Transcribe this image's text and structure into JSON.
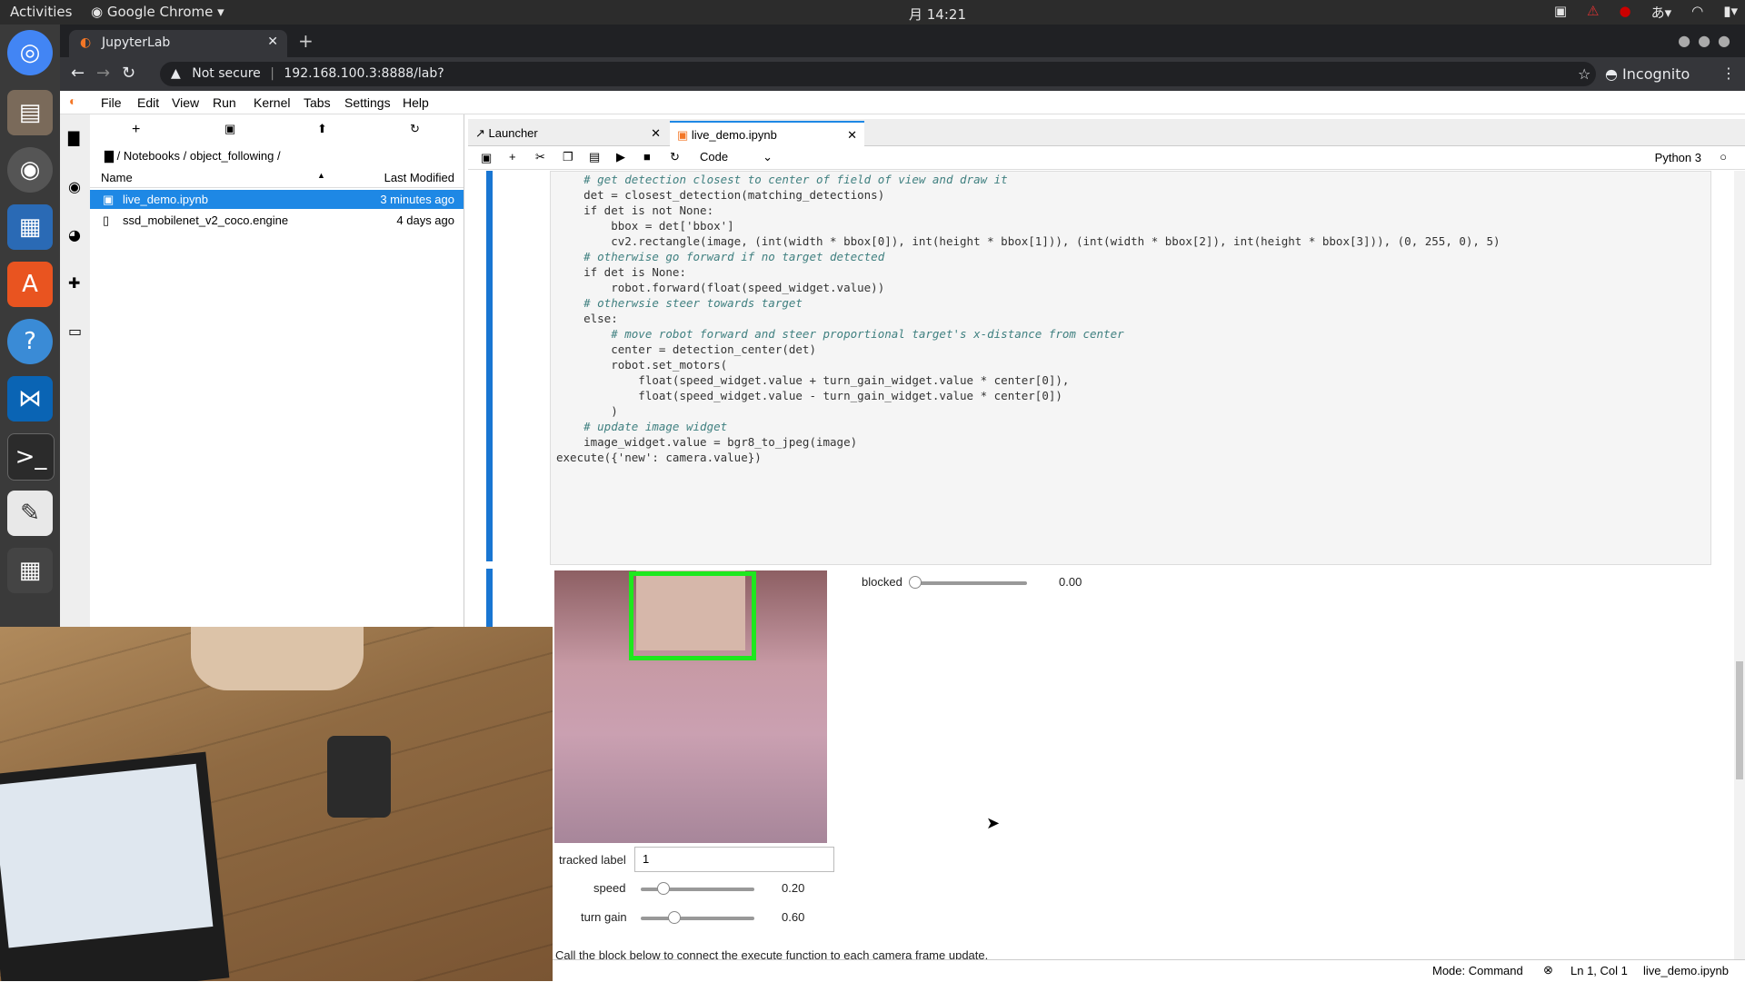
{
  "topbar": {
    "activities": "Activities",
    "app": "Google Chrome",
    "clock": "月 14:21"
  },
  "dock": {
    "items": [
      "chrome",
      "files",
      "rhythmbox",
      "writer",
      "software",
      "help",
      "vscode",
      "terminal",
      "text-editor",
      "calculator"
    ]
  },
  "browser": {
    "tab_title": "JupyterLab",
    "not_secure": "Not secure",
    "url": "192.168.100.3:8888/lab?",
    "profile": "Incognito"
  },
  "jupyter": {
    "menu": [
      "File",
      "Edit",
      "View",
      "Run",
      "Kernel",
      "Tabs",
      "Settings",
      "Help"
    ],
    "breadcrumb": "/ Notebooks / object_following /",
    "columns": {
      "name": "Name",
      "modified": "Last Modified"
    },
    "files": [
      {
        "name": "live_demo.ipynb",
        "modified": "3 minutes ago"
      },
      {
        "name": "ssd_mobilenet_v2_coco.engine",
        "modified": "4 days ago"
      }
    ],
    "doc_tabs": [
      "Launcher",
      "live_demo.ipynb"
    ],
    "cell_type": "Code",
    "kernel": "Python 3",
    "code_lines": [
      "    # get detection closest to center of field of view and draw it",
      "    det = closest_detection(matching_detections)",
      "    if det is not None:",
      "        bbox = det['bbox']",
      "        cv2.rectangle(image, (int(width * bbox[0]), int(height * bbox[1])), (int(width * bbox[2]), int(height * bbox[3])), (0, 255, 0), 5)",
      "",
      "",
      "",
      "    # otherwise go forward if no target detected",
      "    if det is None:",
      "        robot.forward(float(speed_widget.value))",
      "",
      "    # otherwsie steer towards target",
      "    else:",
      "        # move robot forward and steer proportional target's x-distance from center",
      "        center = detection_center(det)",
      "        robot.set_motors(",
      "            float(speed_widget.value + turn_gain_widget.value * center[0]),",
      "            float(speed_widget.value - turn_gain_widget.value * center[0])",
      "        )",
      "",
      "    # update image widget",
      "    image_widget.value = bgr8_to_jpeg(image)",
      "",
      "execute({'new': camera.value})"
    ],
    "widgets": {
      "blocked": {
        "label": "blocked",
        "value": "0.00",
        "fraction": 0.0
      },
      "tracked_label": {
        "label": "tracked label",
        "value": "1"
      },
      "speed": {
        "label": "speed",
        "value": "0.20",
        "fraction": 0.2
      },
      "turn_gain": {
        "label": "turn gain",
        "value": "0.60",
        "fraction": 0.3
      }
    },
    "markdown_next": "Call the block below to connect the execute function to each camera frame update.",
    "status": {
      "mode": "Mode: Command",
      "position": "Ln 1, Col 1",
      "file": "live_demo.ipynb"
    }
  }
}
